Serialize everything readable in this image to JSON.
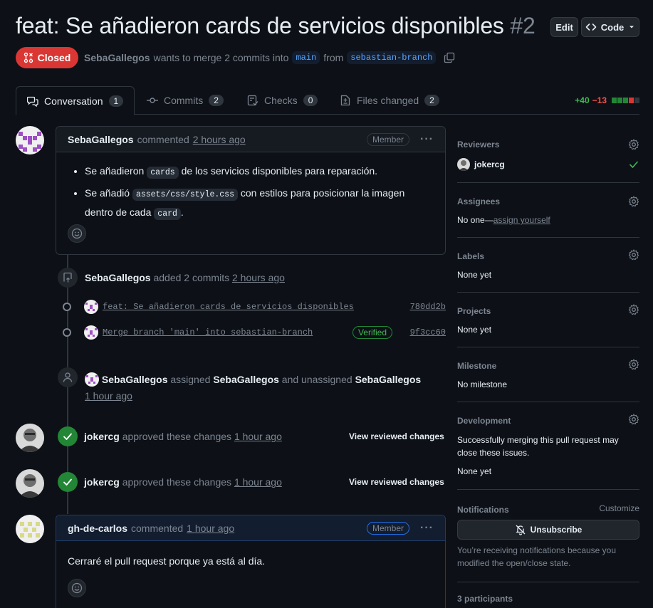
{
  "header": {
    "title": "feat: Se añadieron cards de servicios disponibles",
    "number": "#2",
    "edit_label": "Edit",
    "code_label": "Code",
    "state": "Closed",
    "author": "SebaGallegos",
    "merge_text": "wants to merge 2 commits into",
    "base_branch": "main",
    "from_text": "from",
    "head_branch": "sebastian-branch"
  },
  "tabs": [
    {
      "label": "Conversation",
      "count": "1"
    },
    {
      "label": "Commits",
      "count": "2"
    },
    {
      "label": "Checks",
      "count": "0"
    },
    {
      "label": "Files changed",
      "count": "2"
    }
  ],
  "diffstat": {
    "additions": "+40",
    "deletions": "−13"
  },
  "colors": {
    "closed": "#da3633",
    "green": "#238636",
    "blue_link": "#58a6ff",
    "bg": "#0d1117"
  },
  "timeline": {
    "first_comment": {
      "author": "SebaGallegos",
      "action": "commented",
      "time": "2 hours ago",
      "role": "Member",
      "bullet1_pre": "Se añadieron",
      "bullet1_code": "cards",
      "bullet1_post": "de los servicios disponibles para reparación.",
      "bullet2_pre": "Se añadió",
      "bullet2_code": "assets/css/style.css",
      "bullet2_mid": "con estilos para posicionar la imagen dentro de cada",
      "bullet2_code2": "card",
      "bullet2_post": "."
    },
    "commits_event": {
      "author": "SebaGallegos",
      "action": "added 2 commits",
      "time": "2 hours ago",
      "commits": [
        {
          "message": "feat: Se añadieron cards de servicios disponibles",
          "sha": "780dd2b"
        },
        {
          "message": "Merge branch 'main' into sebastian-branch",
          "sha": "9f3cc60",
          "badge": "Verified"
        }
      ]
    },
    "assign_event": {
      "actor": "SebaGallegos",
      "action1": "assigned",
      "target1": "SebaGallegos",
      "action2": "and unassigned",
      "target2": "SebaGallegos",
      "time": "1 hour ago"
    },
    "reviews": [
      {
        "author": "jokercg",
        "action": "approved these changes",
        "time": "1 hour ago",
        "link": "View reviewed changes"
      },
      {
        "author": "jokercg",
        "action": "approved these changes",
        "time": "1 hour ago",
        "link": "View reviewed changes"
      }
    ],
    "last_comment": {
      "author": "gh-de-carlos",
      "action": "commented",
      "time": "1 hour ago",
      "role": "Member",
      "body": "Cerraré el pull request porque ya está al día."
    }
  },
  "sidebar": {
    "reviewers": {
      "title": "Reviewers",
      "name": "jokercg"
    },
    "assignees": {
      "title": "Assignees",
      "value": "No one—",
      "link": "assign yourself"
    },
    "labels": {
      "title": "Labels",
      "value": "None yet"
    },
    "projects": {
      "title": "Projects",
      "value": "None yet"
    },
    "milestone": {
      "title": "Milestone",
      "value": "No milestone"
    },
    "development": {
      "title": "Development",
      "text": "Successfully merging this pull request may close these issues.",
      "value": "None yet"
    },
    "notifications": {
      "title": "Notifications",
      "customize": "Customize",
      "button": "Unsubscribe",
      "note": "You’re receiving notifications because you modified the open/close state."
    },
    "participants": "3 participants"
  }
}
